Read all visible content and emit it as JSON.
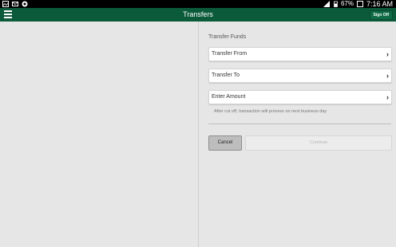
{
  "status_bar": {
    "battery": "67%",
    "time": "7:16 AM"
  },
  "app_bar": {
    "title": "Transfers",
    "sign_off": "Sign Off"
  },
  "form": {
    "section_label": "Transfer Funds",
    "transfer_from": "Transfer From",
    "transfer_to": "Transfer To",
    "enter_amount": "Enter Amount",
    "note": "After cut off, transaction will process on next business day",
    "cancel": "Cancel",
    "continue": "Continue"
  },
  "icons": {
    "menu": "hamburger-menu-icon",
    "chevron": "chevron-right-icon"
  },
  "colors": {
    "app_bar": "#0b5a3a"
  }
}
